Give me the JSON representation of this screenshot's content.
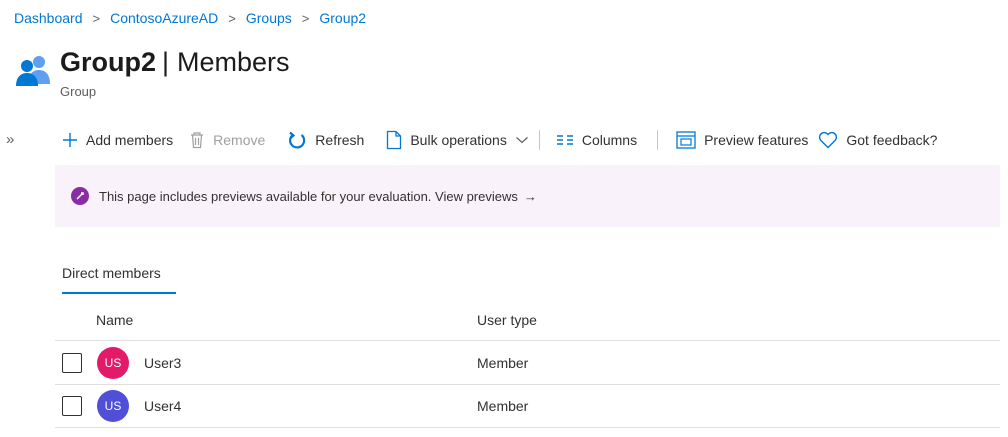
{
  "breadcrumb": {
    "items": [
      "Dashboard",
      "ContosoAzureAD",
      "Groups",
      "Group2"
    ],
    "separator": ">"
  },
  "header": {
    "title": "Group2",
    "divider": "|",
    "section": "Members",
    "subtitle": "Group",
    "icon": "group-icon"
  },
  "nav": {
    "expand_glyph": "»"
  },
  "toolbar": {
    "add_members": "Add members",
    "remove": "Remove",
    "refresh": "Refresh",
    "bulk_operations": "Bulk operations",
    "columns": "Columns",
    "preview_features": "Preview features",
    "got_feedback": "Got feedback?"
  },
  "banner": {
    "text": "This page includes previews available for your evaluation. View previews",
    "arrow": "→",
    "color": "#f9f2fb"
  },
  "tabs": [
    {
      "label": "Direct members",
      "active": true
    }
  ],
  "table": {
    "headers": {
      "name": "Name",
      "user_type": "User type"
    },
    "rows": [
      {
        "initials": "US",
        "name": "User3",
        "user_type": "Member",
        "avatar_color": "#e3196a"
      },
      {
        "initials": "US",
        "name": "User4",
        "user_type": "Member",
        "avatar_color": "#4f4fd8"
      }
    ]
  },
  "colors": {
    "accent": "#0078d4",
    "preview_badge": "#8a2da5"
  }
}
